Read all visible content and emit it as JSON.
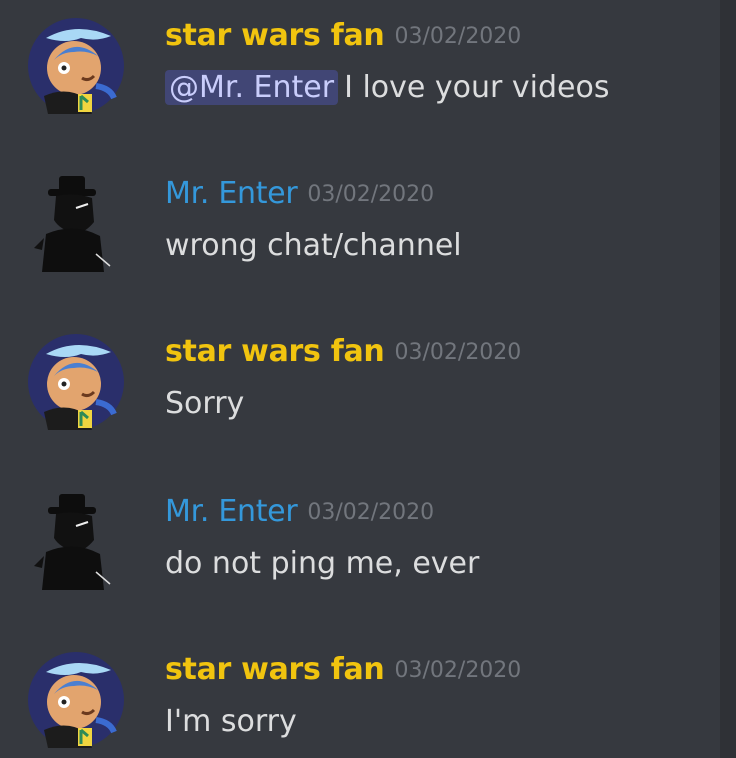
{
  "messages": [
    {
      "author": "star wars fan",
      "timestamp": "03/02/2020",
      "mention": "@Mr. Enter",
      "text": "I love your videos",
      "author_color": "#f1c40f",
      "avatar_icon": "cartoon-character-avatar-icon"
    },
    {
      "author": "Mr. Enter",
      "timestamp": "03/02/2020",
      "text": "wrong chat/channel",
      "author_color": "#3498db",
      "avatar_icon": "black-silhouette-avatar-icon"
    },
    {
      "author": "star wars fan",
      "timestamp": "03/02/2020",
      "text": "Sorry",
      "author_color": "#f1c40f",
      "avatar_icon": "cartoon-character-avatar-icon"
    },
    {
      "author": "Mr. Enter",
      "timestamp": "03/02/2020",
      "text": "do not ping me, ever",
      "author_color": "#3498db",
      "avatar_icon": "black-silhouette-avatar-icon"
    },
    {
      "author": "star wars fan",
      "timestamp": "03/02/2020",
      "text": "I'm sorry",
      "author_color": "#f1c40f",
      "avatar_icon": "cartoon-character-avatar-icon"
    }
  ]
}
